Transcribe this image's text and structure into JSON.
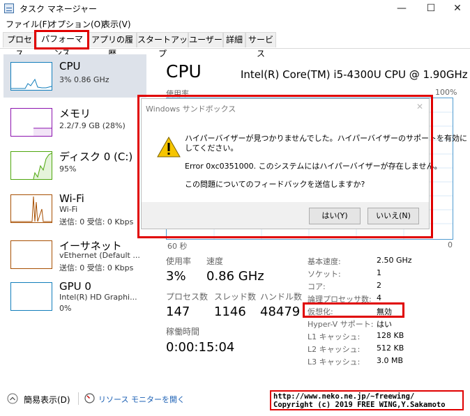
{
  "window": {
    "title": "タスク マネージャー",
    "minimize": "—",
    "maximize": "☐",
    "close": "✕"
  },
  "menu": {
    "file": "ファイル(F)",
    "options": "オプション(O)",
    "view": "表示(V)"
  },
  "tabs": [
    "プロセス",
    "パフォーマンス",
    "アプリの履歴",
    "スタートアップ",
    "ユーザー",
    "詳細",
    "サービス"
  ],
  "sidebar": {
    "cpu": {
      "name": "CPU",
      "sub1": "3%  0.86 GHz"
    },
    "memory": {
      "name": "メモリ",
      "sub1": "2.2/7.9 GB (28%)"
    },
    "disk": {
      "name": "ディスク 0 (C:)",
      "sub1": "95%"
    },
    "wifi": {
      "name": "Wi-Fi",
      "sub1": "Wi-Fi",
      "sub2": "送信: 0  受信: 0 Kbps"
    },
    "ethernet": {
      "name": "イーサネット",
      "sub1": "vEthernet (Default ...",
      "sub2": "送信: 0  受信: 0 Kbps"
    },
    "gpu": {
      "name": "GPU 0",
      "sub1": "Intel(R) HD Graphi...",
      "sub2": "0%"
    }
  },
  "main": {
    "title": "CPU",
    "model": "Intel(R) Core(TM) i5-4300U CPU @ 1.90GHz",
    "usage_label": "使用率",
    "pct100": "100%",
    "sixty": "60 秒",
    "zero": "0"
  },
  "stats": {
    "usage_label": "使用率",
    "usage": "3%",
    "speed_label": "速度",
    "speed": "0.86 GHz",
    "process_label": "プロセス数",
    "process": "147",
    "thread_label": "スレッド数",
    "thread": "1146",
    "handle_label": "ハンドル数",
    "handle": "48479",
    "uptime_label": "稼働時間",
    "uptime": "0:00:15:04"
  },
  "specs": [
    {
      "label": "基本速度:",
      "value": "2.50 GHz"
    },
    {
      "label": "ソケット:",
      "value": "1"
    },
    {
      "label": "コア:",
      "value": "2"
    },
    {
      "label": "論理プロセッサ数:",
      "value": "4"
    },
    {
      "label": "仮想化:",
      "value": "無効"
    },
    {
      "label": "Hyper-V サポート:",
      "value": "はい"
    },
    {
      "label": "L1 キャッシュ:",
      "value": "128 KB"
    },
    {
      "label": "L2 キャッシュ:",
      "value": "512 KB"
    },
    {
      "label": "L3 キャッシュ:",
      "value": "3.0 MB"
    }
  ],
  "dialog": {
    "title": "Windows サンドボックス",
    "close": "✕",
    "line1": "ハイパーバイザーが見つかりませんでした。ハイパーバイザーのサポートを有効に",
    "line2": "してください。",
    "line3": "Error 0xc0351000. このシステムにはハイパーバイザーが存在しません。",
    "line4": "この問題についてのフィードバックを送信しますか?",
    "yes": "はい(Y)",
    "no": "いいえ(N)"
  },
  "footer": {
    "fewer": "簡易表示(D)",
    "monitor": "リソース モニターを開く",
    "url": "http://www.neko.ne.jp/~freewing/",
    "copyright": "Copyright (c) 2019 FREE WING,Y.Sakamoto"
  },
  "colors": {
    "cpu": "#117dbb",
    "memory": "#8b12ae",
    "disk": "#4da60c",
    "wifi": "#a74f01",
    "gpu": "#117dbb",
    "red": "#e00000"
  }
}
